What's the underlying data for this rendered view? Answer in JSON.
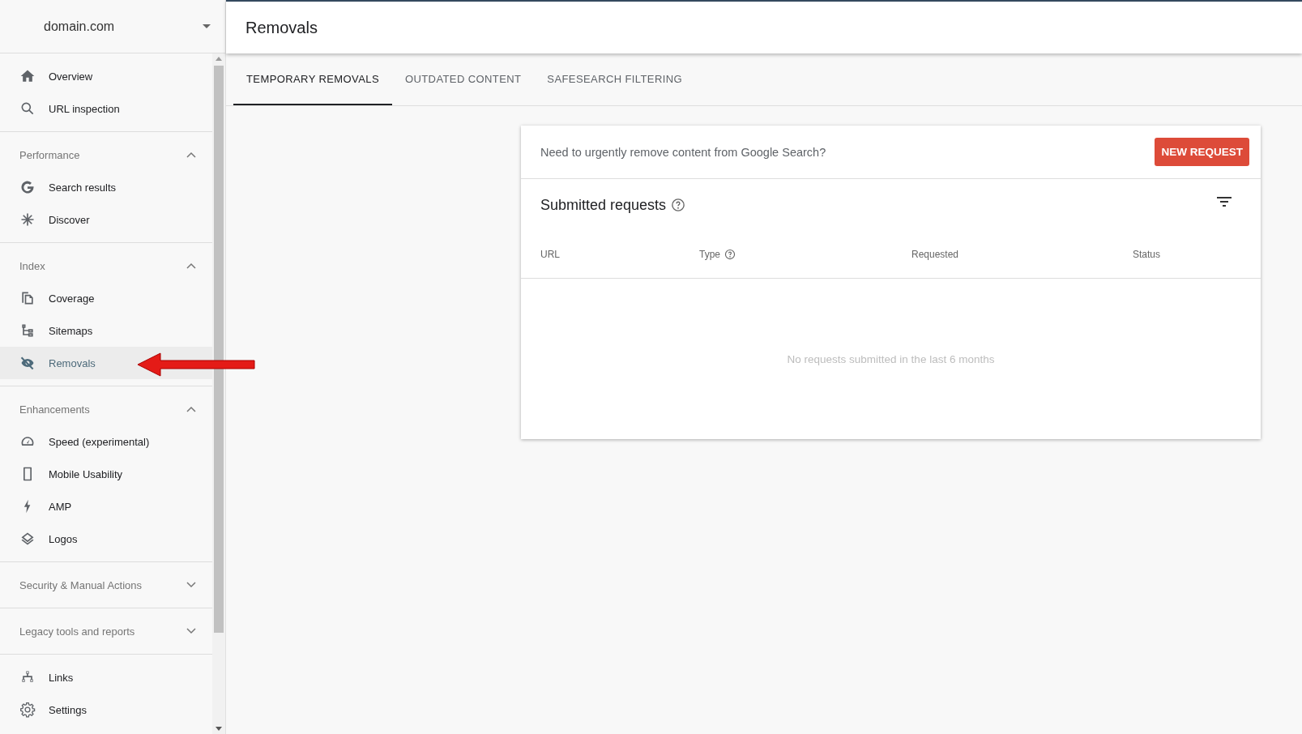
{
  "property": {
    "name": "domain.com"
  },
  "sidebar": {
    "sections": [
      {
        "items": [
          {
            "label": "Overview",
            "selected": false
          },
          {
            "label": "URL inspection",
            "selected": false
          }
        ]
      },
      {
        "title": "Performance",
        "expanded": true,
        "items": [
          {
            "label": "Search results",
            "selected": false
          },
          {
            "label": "Discover",
            "selected": false
          }
        ]
      },
      {
        "title": "Index",
        "expanded": true,
        "items": [
          {
            "label": "Coverage",
            "selected": false
          },
          {
            "label": "Sitemaps",
            "selected": false
          },
          {
            "label": "Removals",
            "selected": true
          }
        ]
      },
      {
        "title": "Enhancements",
        "expanded": true,
        "items": [
          {
            "label": "Speed (experimental)",
            "selected": false
          },
          {
            "label": "Mobile Usability",
            "selected": false
          },
          {
            "label": "AMP",
            "selected": false
          },
          {
            "label": "Logos",
            "selected": false
          }
        ]
      },
      {
        "title": "Security & Manual Actions",
        "expanded": false
      },
      {
        "title": "Legacy tools and reports",
        "expanded": false
      },
      {
        "items": [
          {
            "label": "Links",
            "selected": false
          },
          {
            "label": "Settings",
            "selected": false
          }
        ]
      }
    ]
  },
  "page_title": "Removals",
  "tabs": [
    {
      "label": "TEMPORARY REMOVALS",
      "selected": true
    },
    {
      "label": "OUTDATED CONTENT",
      "selected": false
    },
    {
      "label": "SAFESEARCH FILTERING",
      "selected": false
    }
  ],
  "card": {
    "prompt": "Need to urgently remove content from Google Search?",
    "button": "NEW REQUEST",
    "title": "Submitted requests",
    "columns": [
      {
        "label": "URL",
        "help": false
      },
      {
        "label": "Type",
        "help": true
      },
      {
        "label": "Requested",
        "help": false
      },
      {
        "label": "Status",
        "help": false
      }
    ],
    "empty_message": "No requests submitted in the last 6 months"
  }
}
